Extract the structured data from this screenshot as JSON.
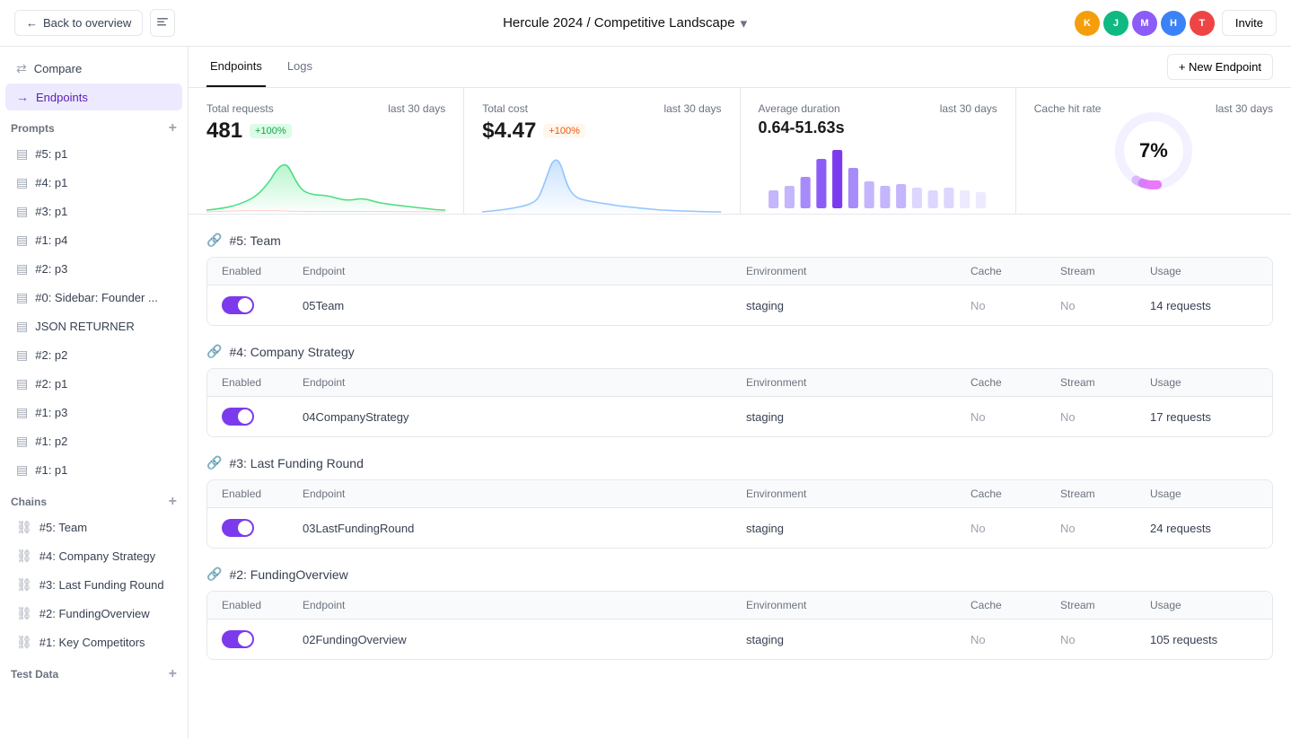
{
  "header": {
    "back_label": "Back to overview",
    "title": "Hercule 2024 / Competitive Landscape",
    "invite_label": "Invite",
    "avatars": [
      {
        "initial": "K",
        "color": "#f59e0b"
      },
      {
        "initial": "J",
        "color": "#10b981"
      },
      {
        "initial": "M",
        "color": "#8b5cf6"
      },
      {
        "initial": "H",
        "color": "#3b82f6"
      },
      {
        "initial": "T",
        "color": "#ef4444"
      }
    ]
  },
  "tabs": {
    "items": [
      {
        "label": "Endpoints",
        "active": true
      },
      {
        "label": "Logs",
        "active": false
      }
    ],
    "new_endpoint_label": "+ New Endpoint"
  },
  "stats": [
    {
      "label": "Total requests",
      "period": "last 30 days",
      "value": "481",
      "badge": "+100%",
      "badge_type": "green",
      "chart_type": "line_green"
    },
    {
      "label": "Total cost",
      "period": "last 30 days",
      "value": "$4.47",
      "badge": "+100%",
      "badge_type": "orange",
      "chart_type": "line_blue"
    },
    {
      "label": "Average duration",
      "period": "last 30 days",
      "value": "0.64-51.63s",
      "badge": "",
      "chart_type": "bar_purple"
    },
    {
      "label": "Cache hit rate",
      "period": "last 30 days",
      "value": "7%",
      "chart_type": "donut"
    }
  ],
  "endpoint_sections": [
    {
      "title": "#5: Team",
      "columns": [
        "Enabled",
        "Endpoint",
        "Environment",
        "Cache",
        "Stream",
        "Usage"
      ],
      "rows": [
        {
          "enabled": true,
          "endpoint": "05Team",
          "environment": "staging",
          "cache": "No",
          "stream": "No",
          "usage": "14 requests"
        }
      ]
    },
    {
      "title": "#4: Company Strategy",
      "columns": [
        "Enabled",
        "Endpoint",
        "Environment",
        "Cache",
        "Stream",
        "Usage"
      ],
      "rows": [
        {
          "enabled": true,
          "endpoint": "04CompanyStrategy",
          "environment": "staging",
          "cache": "No",
          "stream": "No",
          "usage": "17 requests"
        }
      ]
    },
    {
      "title": "#3: Last Funding Round",
      "columns": [
        "Enabled",
        "Endpoint",
        "Environment",
        "Cache",
        "Stream",
        "Usage"
      ],
      "rows": [
        {
          "enabled": true,
          "endpoint": "03LastFundingRound",
          "environment": "staging",
          "cache": "No",
          "stream": "No",
          "usage": "24 requests"
        }
      ]
    },
    {
      "title": "#2: FundingOverview",
      "columns": [
        "Enabled",
        "Endpoint",
        "Environment",
        "Cache",
        "Stream",
        "Usage"
      ],
      "rows": [
        {
          "enabled": true,
          "endpoint": "02FundingOverview",
          "environment": "staging",
          "cache": "No",
          "stream": "No",
          "usage": "105 requests"
        }
      ]
    }
  ],
  "sidebar": {
    "nav_items": [
      {
        "label": "Compare",
        "icon": "⇄",
        "active": false
      },
      {
        "label": "Endpoints",
        "icon": "→",
        "active": true
      }
    ],
    "prompts_label": "Prompts",
    "prompts": [
      {
        "label": "#5: p1"
      },
      {
        "label": "#4: p1"
      },
      {
        "label": "#3: p1"
      },
      {
        "label": "#1: p4"
      },
      {
        "label": "#2: p3"
      },
      {
        "label": "#0: Sidebar: Founder ..."
      },
      {
        "label": "JSON RETURNER"
      },
      {
        "label": "#2: p2"
      },
      {
        "label": "#2: p1"
      },
      {
        "label": "#1: p3"
      },
      {
        "label": "#1: p2"
      },
      {
        "label": "#1: p1"
      }
    ],
    "chains_label": "Chains",
    "chains": [
      {
        "label": "#5: Team"
      },
      {
        "label": "#4: Company Strategy"
      },
      {
        "label": "#3: Last Funding Round"
      },
      {
        "label": "#2: FundingOverview"
      },
      {
        "label": "#1: Key Competitors"
      }
    ],
    "test_data_label": "Test Data"
  }
}
